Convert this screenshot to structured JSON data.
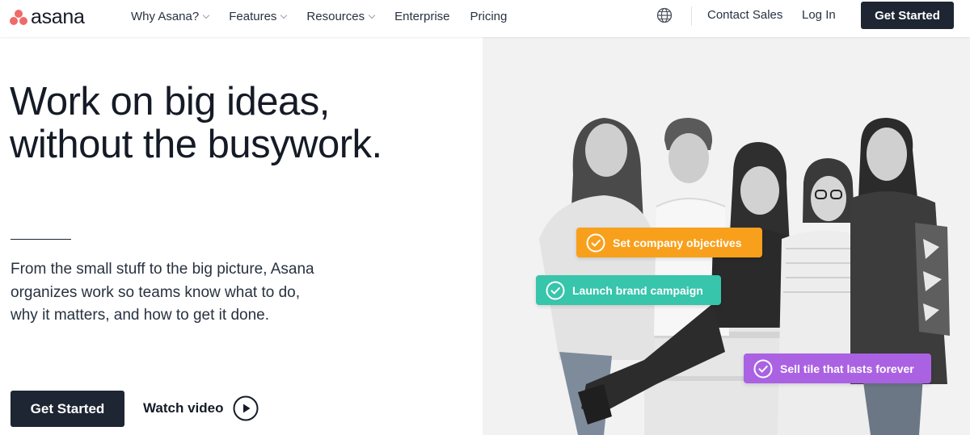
{
  "brand": {
    "name": "asana",
    "logo_color": "#f06a6a"
  },
  "nav": {
    "items": [
      {
        "label": "Why Asana?",
        "dropdown": true
      },
      {
        "label": "Features",
        "dropdown": true
      },
      {
        "label": "Resources",
        "dropdown": true
      },
      {
        "label": "Enterprise",
        "dropdown": false
      },
      {
        "label": "Pricing",
        "dropdown": false
      }
    ],
    "globe_icon": "globe-icon",
    "contact_sales": "Contact Sales",
    "login": "Log In",
    "get_started": "Get Started"
  },
  "hero": {
    "headline_line1": "Work on big ideas,",
    "headline_line2": "without the busywork.",
    "lead_text": "From the small stuff to the big picture, Asana organizes work so teams know what to do, why it matters, and how to get it done.",
    "cta_label": "Get Started",
    "watch_video_label": "Watch video",
    "play_icon": "play-circle-icon"
  },
  "tasks": [
    {
      "label": "Set company objectives",
      "color": "#f8a01c",
      "icon": "check-circle-icon"
    },
    {
      "label": "Launch brand campaign",
      "color": "#37c5ab",
      "icon": "check-circle-icon"
    },
    {
      "label": "Sell tile that lasts forever",
      "color": "#aa62e3",
      "icon": "check-circle-icon"
    }
  ],
  "colors": {
    "dark": "#1e2633",
    "text": "#151b26",
    "hero_bg": "#f2f2f2"
  }
}
